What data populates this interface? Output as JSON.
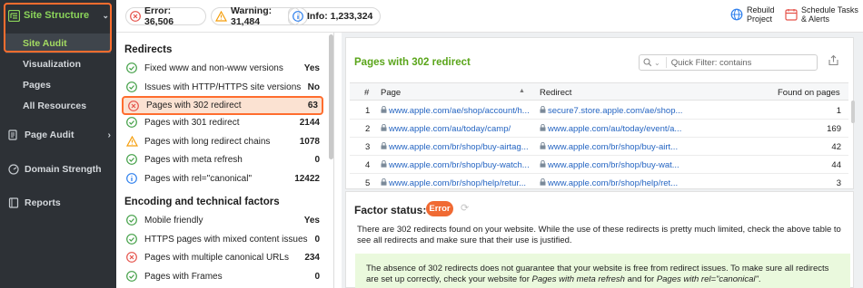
{
  "sidebar": {
    "section": "Site Structure",
    "sub_items": [
      "Site Audit",
      "Visualization",
      "Pages",
      "All Resources"
    ],
    "page_audit": "Page Audit",
    "domain_strength": "Domain Strength",
    "reports": "Reports"
  },
  "topbar": {
    "error": "Error: 36,506",
    "warning": "Warning: 31,484",
    "info": "Info: 1,233,324",
    "rebuild": [
      "Rebuild",
      "Project"
    ],
    "schedule": [
      "Schedule Tasks",
      "& Alerts"
    ]
  },
  "left": {
    "groups": [
      {
        "title": "Redirects",
        "rows": [
          {
            "status": "ok",
            "label": "Fixed www and non-www versions",
            "value": "Yes"
          },
          {
            "status": "ok",
            "label": "Issues with HTTP/HTTPS site versions",
            "value": "No"
          },
          {
            "status": "error",
            "label": "Pages with 302 redirect",
            "value": "63"
          },
          {
            "status": "ok",
            "label": "Pages with 301 redirect",
            "value": "2144"
          },
          {
            "status": "warning",
            "label": "Pages with long redirect chains",
            "value": "1078"
          },
          {
            "status": "ok",
            "label": "Pages with meta refresh",
            "value": "0"
          },
          {
            "status": "info",
            "label": "Pages with rel=\"canonical\"",
            "value": "12422"
          }
        ]
      },
      {
        "title": "Encoding and technical factors",
        "rows": [
          {
            "status": "ok",
            "label": "Mobile friendly",
            "value": "Yes"
          },
          {
            "status": "ok",
            "label": "HTTPS pages with mixed content issues",
            "value": "0"
          },
          {
            "status": "error",
            "label": "Pages with multiple canonical URLs",
            "value": "234"
          },
          {
            "status": "ok",
            "label": "Pages with Frames",
            "value": "0"
          }
        ]
      }
    ]
  },
  "table": {
    "title": "Pages with 302 redirect",
    "filter_placeholder": "Quick Filter: contains",
    "columns": [
      "#",
      "Page",
      "Redirect",
      "Found on pages"
    ],
    "rows": [
      {
        "n": "1",
        "page": "www.apple.com/ae/shop/account/h...",
        "redirect": "secure7.store.apple.com/ae/shop...",
        "found": "1"
      },
      {
        "n": "2",
        "page": "www.apple.com/au/today/camp/",
        "redirect": "www.apple.com/au/today/event/a...",
        "found": "169"
      },
      {
        "n": "3",
        "page": "www.apple.com/br/shop/buy-airtag...",
        "redirect": "www.apple.com/br/shop/buy-airt...",
        "found": "42"
      },
      {
        "n": "4",
        "page": "www.apple.com/br/shop/buy-watch...",
        "redirect": "www.apple.com/br/shop/buy-wat...",
        "found": "44"
      },
      {
        "n": "5",
        "page": "www.apple.com/br/shop/help/retur...",
        "redirect": "www.apple.com/br/shop/help/ret...",
        "found": "3"
      }
    ]
  },
  "factor": {
    "label": "Factor status:",
    "badge": "Error",
    "text": "There are 302 redirects found on your website. While the use of these redirects is pretty much limited, check the above table to see all redirects and make sure that their use is justified.",
    "note_prefix": "The absence of 302 redirects does not guarantee that your website is free from redirect issues. To make sure all redirects are set up correctly, check your website for ",
    "note_em1": "Pages with meta refresh",
    "note_mid": " and for ",
    "note_em2": "Pages with rel=\"canonical\"",
    "note_end": "."
  },
  "colors": {
    "ok": "#43a047",
    "error": "#e5534b",
    "warning": "#f59e0b",
    "info": "#2f80ed",
    "accent": "#ff6d2e",
    "link": "#2565c2"
  }
}
